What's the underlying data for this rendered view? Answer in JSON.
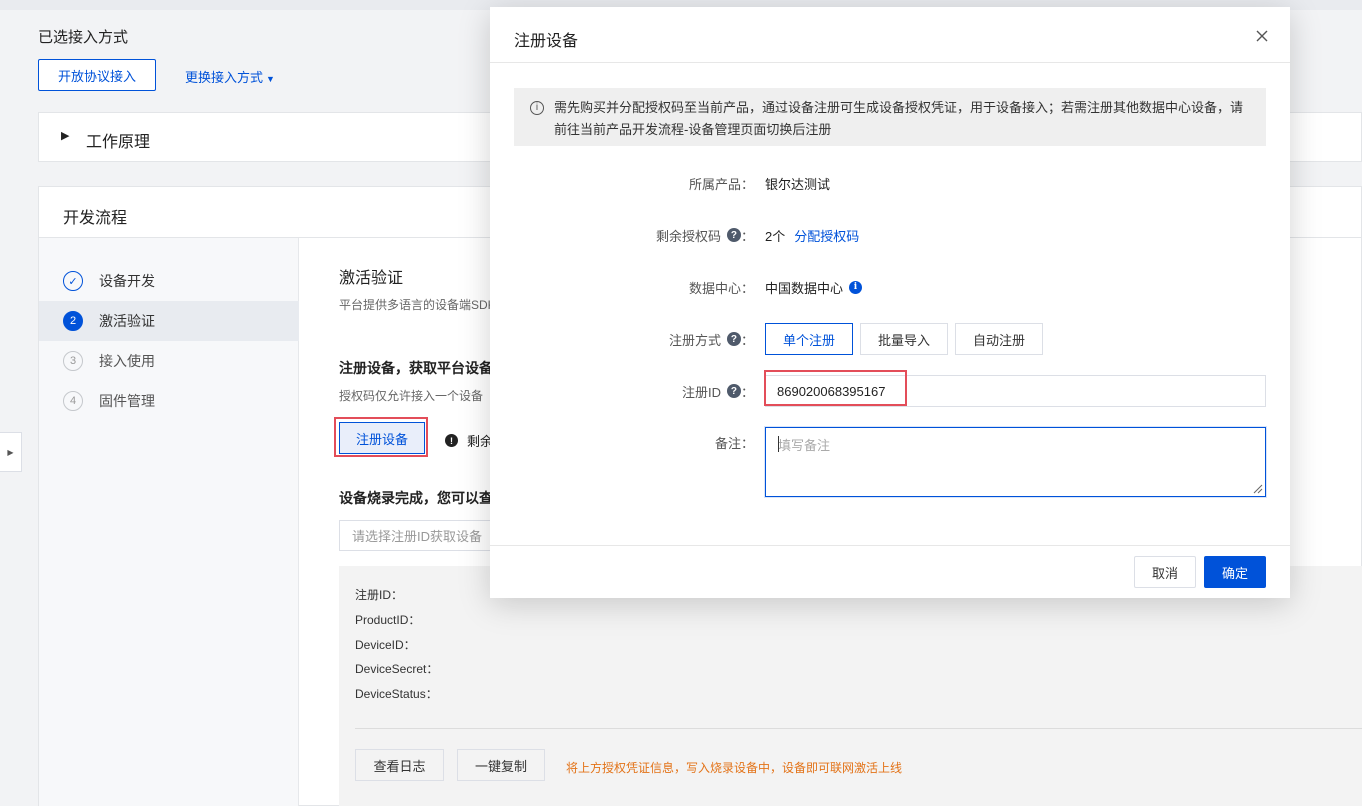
{
  "background": {
    "selected_title": "已选接入方式",
    "open_protocol_button": "开放协议接入",
    "switch_method_link": "更换接入方式",
    "principle_panel_label": "工作原理",
    "dev_flow_title": "开发流程",
    "steps": [
      {
        "number": "✓",
        "label": "设备开发",
        "state": "done"
      },
      {
        "number": "2",
        "label": "激活验证",
        "state": "current"
      },
      {
        "number": "3",
        "label": "接入使用",
        "state": "pending"
      },
      {
        "number": "4",
        "label": "固件管理",
        "state": "pending"
      }
    ],
    "activation_title": "激活验证",
    "activation_desc": "平台提供多语言的设备端SDK",
    "register_title": "注册设备，获取平台设备",
    "register_desc": "授权码仅允许接入一个设备",
    "register_button": "注册设备",
    "remaining_text": "剩余",
    "burn_title": "设备烧录完成，您可以查",
    "select_placeholder": "请选择注册ID获取设备",
    "info_lines": [
      "注册ID：",
      "ProductID：",
      "DeviceID：",
      "DeviceSecret：",
      "DeviceStatus："
    ],
    "view_log_button": "查看日志",
    "copy_button": "一键复制",
    "tip_text": "将上方授权凭证信息，写入烧录设备中，设备即可联网激活上线"
  },
  "modal": {
    "title": "注册设备",
    "notice": "需先购买并分配授权码至当前产品，通过设备注册可生成设备授权凭证，用于设备接入；若需注册其他数据中心设备，请前往当前产品开发流程-设备管理页面切换后注册",
    "product_label": "所属产品：",
    "product_value": "银尔达测试",
    "license_label": "剩余授权码",
    "license_colon": "：",
    "license_value": "2个",
    "license_link": "分配授权码",
    "datacenter_label": "数据中心：",
    "datacenter_value": "中国数据中心",
    "method_label": "注册方式",
    "method_colon": "：",
    "methods": [
      "单个注册",
      "批量导入",
      "自动注册"
    ],
    "selected_method": "单个注册",
    "reg_id_label": "注册ID",
    "reg_id_colon": "：",
    "reg_id_value": "869020068395167",
    "remark_label": "备注：",
    "remark_placeholder": "填写备注",
    "cancel_button": "取消",
    "ok_button": "确定"
  },
  "colors": {
    "primary": "#0052d9",
    "highlight": "#e34d59",
    "warning": "#e37318"
  },
  "icons": [
    "close-icon",
    "info-circle-icon",
    "help-icon",
    "caret-down-icon",
    "caret-right-icon",
    "check-icon"
  ]
}
